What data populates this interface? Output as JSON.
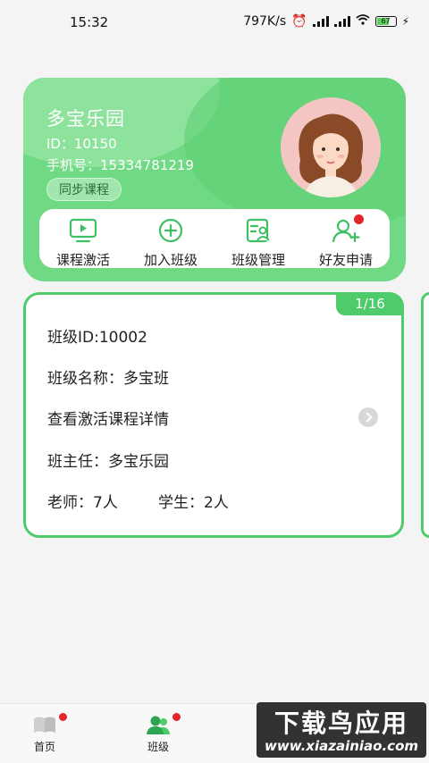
{
  "status_bar": {
    "time": "15:32",
    "network": "797K/s",
    "battery": "67",
    "icons": [
      "alarm-icon",
      "signal-icon",
      "signal-icon",
      "wifi-icon",
      "battery-icon",
      "charging-icon"
    ]
  },
  "profile": {
    "name": "多宝乐园",
    "id_line": "ID：10150",
    "phone_line": "手机号：15334781219",
    "sync_button": "同步课程"
  },
  "actions": [
    {
      "label": "课程激活",
      "icon": "play-screen-icon"
    },
    {
      "label": "加入班级",
      "icon": "plus-circle-icon"
    },
    {
      "label": "班级管理",
      "icon": "class-manage-icon"
    },
    {
      "label": "好友申请",
      "icon": "add-friend-icon",
      "badge": true
    }
  ],
  "class_card": {
    "page_indicator": "1/16",
    "class_id": "班级ID:10002",
    "class_name": "班级名称：多宝班",
    "activation_details": "查看激活课程详情",
    "head_teacher": "班主任：多宝乐园",
    "teachers": "老师：7人",
    "students": "学生：2人"
  },
  "bottom_nav": [
    {
      "label": "首页",
      "icon": "book-icon",
      "badge": true
    },
    {
      "label": "班级",
      "icon": "people-icon",
      "badge": true,
      "active": true
    },
    {
      "label": "",
      "icon": "unknown"
    },
    {
      "label": "",
      "icon": "unknown"
    }
  ],
  "watermark": {
    "title": "下载鸟应用",
    "url": "www.xiazainiao.com"
  },
  "colors": {
    "primary_green": "#4ecb6a",
    "card_green": "#6fd983",
    "badge_red": "#e4252c"
  }
}
